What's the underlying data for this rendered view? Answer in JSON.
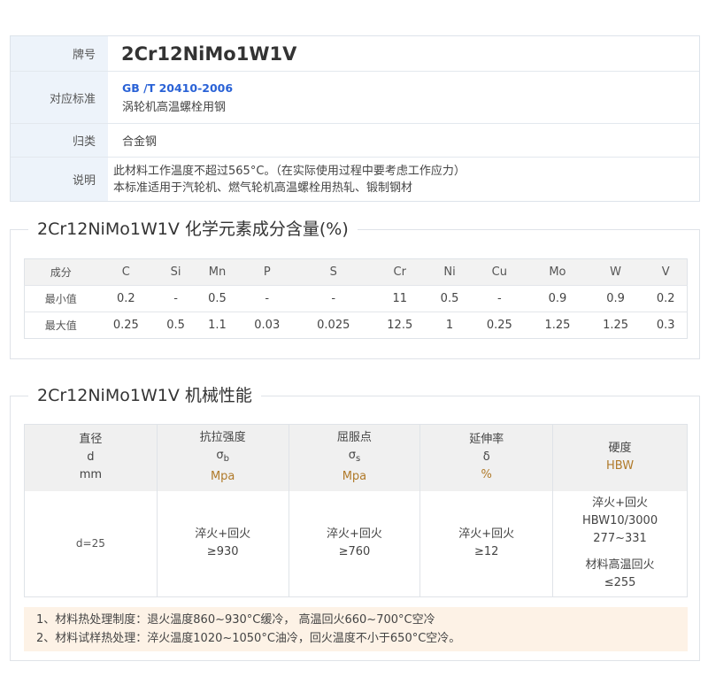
{
  "info": {
    "grade_label": "牌号",
    "grade_value": "2Cr12NiMo1W1V",
    "standard_label": "对应标准",
    "standard_code": "GB /T 20410-2006",
    "standard_name": "涡轮机高温螺栓用钢",
    "category_label": "归类",
    "category_value": "合金钢",
    "desc_label": "说明",
    "desc_line1": "此材料工作温度不超过565°C。（在实际使用过程中要考虑工作应力）",
    "desc_line2": "本标准适用于汽轮机、燃气轮机高温螺栓用热轧、锻制钢材"
  },
  "chem": {
    "title": "2Cr12NiMo1W1V 化学元素成分含量(%)",
    "header": [
      "成分",
      "C",
      "Si",
      "Mn",
      "P",
      "S",
      "Cr",
      "Ni",
      "Cu",
      "Mo",
      "W",
      "V"
    ],
    "rows": [
      [
        "最小值",
        "0.2",
        "-",
        "0.5",
        "-",
        "-",
        "11",
        "0.5",
        "-",
        "0.9",
        "0.9",
        "0.2"
      ],
      [
        "最大值",
        "0.25",
        "0.5",
        "1.1",
        "0.03",
        "0.025",
        "12.5",
        "1",
        "0.25",
        "1.25",
        "1.25",
        "0.3"
      ]
    ]
  },
  "mech": {
    "title": "2Cr12NiMo1W1V 机械性能",
    "h_diameter": "直径",
    "h_diameter_sym": "d",
    "h_diameter_unit": "mm",
    "h_tensile": "抗拉强度",
    "h_tensile_sym": "σ",
    "h_tensile_sub": "b",
    "h_tensile_unit": "Mpa",
    "h_yield": "屈服点",
    "h_yield_sym": "σ",
    "h_yield_sub": "s",
    "h_yield_unit": "Mpa",
    "h_elong": "延伸率",
    "h_elong_sym": "δ",
    "h_elong_unit": "%",
    "h_hard": "硬度",
    "h_hard_unit": "HBW",
    "d_value": "d=25",
    "tensile_cond": "淬火+回火",
    "tensile_val": "≥930",
    "yield_cond": "淬火+回火",
    "yield_val": "≥760",
    "elong_cond": "淬火+回火",
    "elong_val": "≥12",
    "hard_cond": "淬火+回火",
    "hard_method": "HBW10/3000",
    "hard_range": "277~331",
    "hard_anneal": "材料高温回火",
    "hard_anneal_val": "≤255"
  },
  "notes": {
    "line1": "1、材料热处理制度：退火温度860~930°C缓冷， 高温回火660~700°C空冷",
    "line2": "2、材料试样热处理：淬火温度1020~1050°C油冷，回火温度不小于650°C空冷。"
  },
  "colors": {
    "label_bg": "#edf3fa",
    "link": "#2a62d6",
    "unit": "#b07a2a",
    "notes_bg": "#fdf2e6"
  }
}
